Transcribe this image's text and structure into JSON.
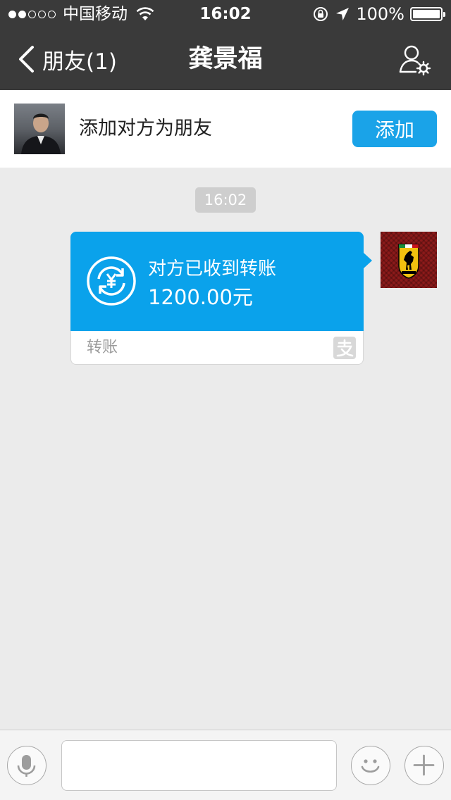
{
  "status_bar": {
    "carrier": "中国移动",
    "time": "16:02",
    "battery": "100%",
    "signal_bars": 2,
    "signal_total": 5
  },
  "nav": {
    "back_label": "朋友(1)",
    "title": "龚景福"
  },
  "add_friend": {
    "prompt": "添加对方为朋友",
    "button_label": "添加"
  },
  "chat": {
    "timestamp": "16:02",
    "transfer": {
      "status_text": "对方已收到转账",
      "amount": "1200.00元",
      "type_label": "转账"
    }
  },
  "input_bar": {
    "text_value": ""
  },
  "colors": {
    "nav_background": "#3a3a3a",
    "accent_blue": "#1aa3e8",
    "transfer_blue": "#0aa2eb",
    "chat_background": "#ebebeb"
  },
  "icons": {
    "back": "chevron-left-icon",
    "profile": "user-settings-icon",
    "transfer": "yuan-exchange-icon",
    "payment_brand": "alipay-icon",
    "voice": "microphone-icon",
    "emoji": "smiley-icon",
    "more": "plus-icon"
  }
}
